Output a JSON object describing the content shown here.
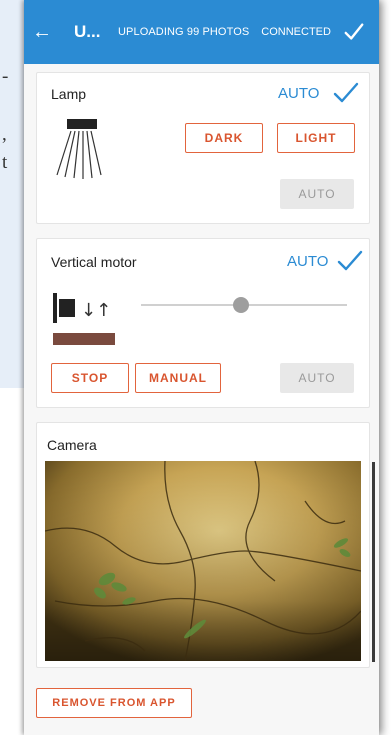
{
  "background_doc": {
    "fragments": [
      "-",
      ",",
      "t"
    ]
  },
  "appbar": {
    "title": "U...",
    "status": "UPLOADING 99 PHOTOS",
    "connection": "CONNECTED",
    "back_icon": "arrow-left-icon",
    "confirm_icon": "checkmark-icon",
    "color": "#2b8bd3"
  },
  "lamp": {
    "title": "Lamp",
    "mode": "AUTO",
    "icon": "lamp-icon",
    "buttons": {
      "dark": "DARK",
      "light": "LIGHT",
      "auto": "AUTO"
    }
  },
  "vertical_motor": {
    "title": "Vertical motor",
    "mode": "AUTO",
    "icon": "motor-icon",
    "slider_level": 0.5,
    "buttons": {
      "stop": "STOP",
      "manual": "MANUAL",
      "auto": "AUTO"
    }
  },
  "camera": {
    "title": "Camera",
    "image": "camera-feed-image"
  },
  "actions": {
    "remove": "REMOVE FROM APP"
  },
  "colors": {
    "accent": "#2b8bd3",
    "button": "#e2643d"
  }
}
